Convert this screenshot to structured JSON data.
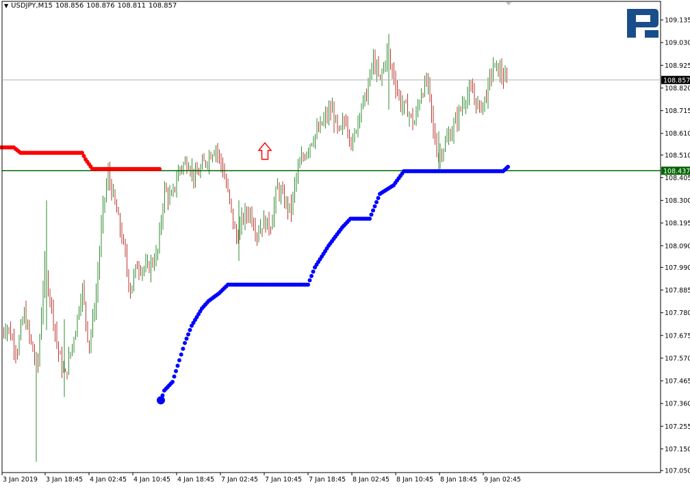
{
  "header": {
    "symbol": "USDJPY,M15",
    "open": "108.856",
    "high": "108.876",
    "low": "108.811",
    "close": "108.857"
  },
  "colors": {
    "bull": "#2e8b2e",
    "bear": "#b8342e",
    "resistance": "#ff0000",
    "support": "#0000ff",
    "hline": "#006400",
    "bid": "#b0b0b0",
    "logo": "#1a4e8a",
    "arrow": "#ff0000"
  },
  "icons": {
    "logo": "roboforex-logo-icon",
    "up_arrow": "up-arrow-icon",
    "scroll": "scroll-marker-icon"
  },
  "chart_data": {
    "type": "candlestick",
    "title": "USDJPY,M15",
    "ylim": [
      107.05,
      109.17
    ],
    "y_ticks": [
      "109.135",
      "109.030",
      "108.925",
      "108.820",
      "108.715",
      "108.610",
      "108.510",
      "108.405",
      "108.300",
      "108.195",
      "108.090",
      "107.990",
      "107.885",
      "107.780",
      "107.675",
      "107.570",
      "107.465",
      "107.360",
      "107.255",
      "107.150",
      "107.050"
    ],
    "x_ticks": [
      "3 Jan 2019",
      "3 Jan 18:45",
      "4 Jan 02:45",
      "4 Jan 10:45",
      "4 Jan 18:45",
      "7 Jan 02:45",
      "7 Jan 10:45",
      "7 Jan 18:45",
      "8 Jan 02:45",
      "8 Jan 10:45",
      "8 Jan 18:45",
      "9 Jan 02:45"
    ],
    "price_labels": {
      "bid": "108.857",
      "level": "108.437"
    },
    "horizontal_line": 108.437,
    "bid_line": 108.857,
    "price_path": [
      [
        0,
        107.68
      ],
      [
        10,
        107.72
      ],
      [
        25,
        107.6
      ],
      [
        35,
        107.78
      ],
      [
        45,
        107.64
      ],
      [
        55,
        107.52
      ],
      [
        65,
        108.0
      ],
      [
        75,
        107.82
      ],
      [
        85,
        107.6
      ],
      [
        95,
        107.48
      ],
      [
        110,
        107.7
      ],
      [
        120,
        107.9
      ],
      [
        130,
        107.62
      ],
      [
        140,
        107.85
      ],
      [
        150,
        108.25
      ],
      [
        158,
        108.42
      ],
      [
        170,
        108.25
      ],
      [
        180,
        108.1
      ],
      [
        190,
        107.88
      ],
      [
        200,
        108.0
      ],
      [
        215,
        107.98
      ],
      [
        230,
        108.05
      ],
      [
        240,
        108.35
      ],
      [
        250,
        108.3
      ],
      [
        262,
        108.45
      ],
      [
        275,
        108.48
      ],
      [
        285,
        108.4
      ],
      [
        300,
        108.48
      ],
      [
        315,
        108.55
      ],
      [
        325,
        108.45
      ],
      [
        335,
        108.3
      ],
      [
        345,
        108.12
      ],
      [
        355,
        108.22
      ],
      [
        365,
        108.25
      ],
      [
        375,
        108.15
      ],
      [
        385,
        108.2
      ],
      [
        395,
        108.18
      ],
      [
        405,
        108.36
      ],
      [
        415,
        108.3
      ],
      [
        425,
        108.25
      ],
      [
        432,
        108.4
      ],
      [
        440,
        108.48
      ],
      [
        455,
        108.58
      ],
      [
        465,
        108.62
      ],
      [
        475,
        108.68
      ],
      [
        485,
        108.72
      ],
      [
        495,
        108.6
      ],
      [
        505,
        108.68
      ],
      [
        515,
        108.55
      ],
      [
        525,
        108.72
      ],
      [
        535,
        108.78
      ],
      [
        545,
        108.95
      ],
      [
        555,
        108.85
      ],
      [
        565,
        108.98
      ],
      [
        575,
        108.88
      ],
      [
        585,
        108.75
      ],
      [
        595,
        108.72
      ],
      [
        605,
        108.65
      ],
      [
        615,
        108.8
      ],
      [
        625,
        108.85
      ],
      [
        633,
        108.62
      ],
      [
        640,
        108.5
      ],
      [
        650,
        108.56
      ],
      [
        660,
        108.62
      ],
      [
        670,
        108.7
      ],
      [
        680,
        108.78
      ],
      [
        690,
        108.8
      ],
      [
        700,
        108.72
      ],
      [
        710,
        108.78
      ],
      [
        720,
        108.92
      ],
      [
        730,
        108.9
      ],
      [
        740,
        108.84
      ]
    ],
    "series": [
      {
        "name": "",
        "style": "dotted-line",
        "points": [
          [
            0,
            108.545
          ],
          [
            20,
            108.545
          ],
          [
            30,
            108.52
          ],
          [
            120,
            108.52
          ],
          [
            125,
            108.49
          ],
          [
            135,
            108.445
          ],
          [
            233,
            108.445
          ]
        ]
      },
      {
        "name": "",
        "style": "dotted-line",
        "points": [
          [
            235,
            107.375
          ],
          [
            240,
            107.42
          ],
          [
            252,
            107.46
          ],
          [
            262,
            107.56
          ],
          [
            270,
            107.64
          ],
          [
            280,
            107.72
          ],
          [
            295,
            107.8
          ],
          [
            305,
            107.835
          ],
          [
            320,
            107.87
          ],
          [
            333,
            107.91
          ],
          [
            450,
            107.91
          ],
          [
            460,
            107.99
          ],
          [
            480,
            108.09
          ],
          [
            500,
            108.175
          ],
          [
            512,
            108.215
          ],
          [
            540,
            108.215
          ],
          [
            555,
            108.33
          ],
          [
            575,
            108.37
          ],
          [
            590,
            108.435
          ],
          [
            735,
            108.435
          ],
          [
            742,
            108.455
          ]
        ]
      }
    ],
    "annotations": [
      {
        "type": "up-arrow",
        "x": 387,
        "y": 108.49
      }
    ]
  }
}
